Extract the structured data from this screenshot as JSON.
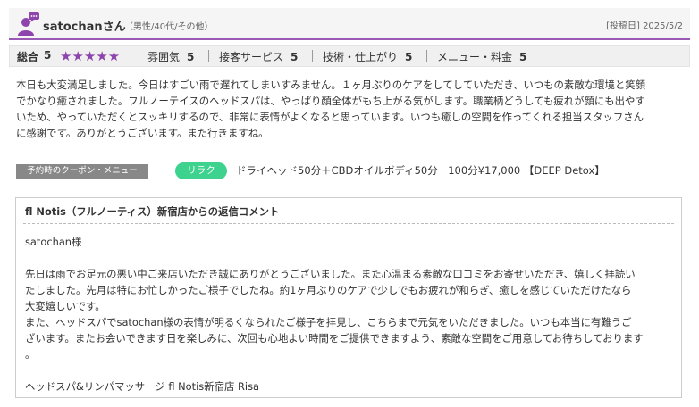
{
  "header": {
    "user_name": "satochanさん",
    "user_meta": "（男性/40代/その他）",
    "post_date": "[投稿日] 2025/5/2"
  },
  "ratings": {
    "overall_label": "総合",
    "overall_value": "5",
    "stars": "★★★★★",
    "items": [
      {
        "label": "雰囲気",
        "value": "5"
      },
      {
        "label": "接客サービス",
        "value": "5"
      },
      {
        "label": "技術・仕上がり",
        "value": "5"
      },
      {
        "label": "メニュー・料金",
        "value": "5"
      }
    ],
    "star_color": "#8e44ad"
  },
  "review": {
    "text": "本日も大変満足しました。今日はすごい雨で遅れてしまいすみません。１ヶ月ぶりのケアをしてしていただき、いつもの素敵な環境と笑顔\nでかなり癒されました。フルノーテイスのヘッドスパは、やっぱり顔全体がもち上がる気がします。職業柄どうしても疲れが顔にも出やす\nいため、やっていただくとスッキリするので、非常に表情がよくなると思っています。いつも癒しの空間を作ってくれる担当スタッフさん\nに感謝です。ありがとうございます。また行きますね。"
  },
  "coupon": {
    "label": "予約時のクーポン・メニュー",
    "tag": "リラク",
    "text": "ドライヘッド50分＋CBDオイルボディ50分　100分¥17,000 【DEEP Detox】",
    "tag_color": "#3dd28e"
  },
  "reply": {
    "title": "fl Notis（フルノーティス）新宿店からの返信コメント",
    "body": "satochan様\n\n先日は雨でお足元の悪い中ご来店いただき誠にありがとうございました。また心温まる素敵な口コミをお寄せいただき、嬉しく拝読い\nたしました。先月は特にお忙しかったご様子でしたね。約1ヶ月ぶりのケアで少しでもお疲れが和らぎ、癒しを感じていただけたなら\n大変嬉しいです。\nまた、ヘッドスパでsatochan様の表情が明るくなられたご様子を拝見し、こちらまで元気をいただきました。いつも本当に有難うご\nざいます。またお会いできます日を楽しみに、次回も心地よい時間をご提供できますよう、素敵な空間をご用意してお待ちしております\n。\n\nヘッドスパ&リンパマッサージ fl Notis新宿店 Risa"
  },
  "icons": {
    "user": "user-comment-icon"
  },
  "colors": {
    "accent": "#9b59b6"
  }
}
